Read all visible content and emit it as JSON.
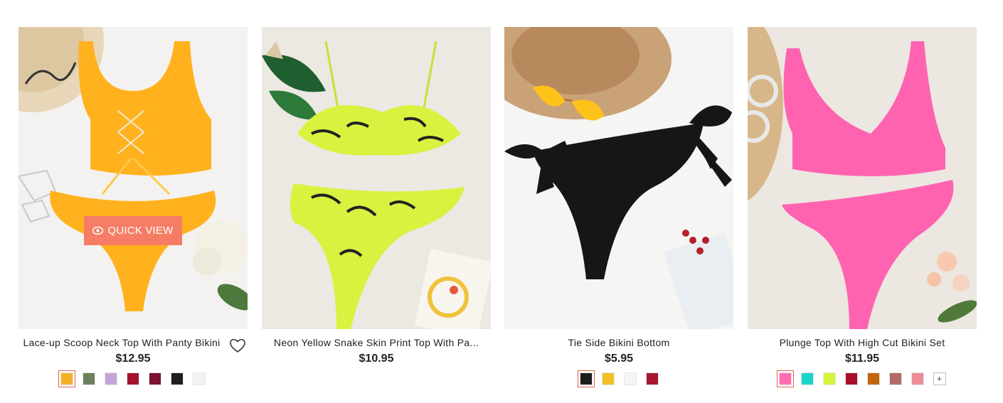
{
  "products": [
    {
      "name": "Lace-up Scoop Neck Top With Panty Bikini",
      "price": "$12.95",
      "quick_view_label": "QUICK VIEW",
      "colors": [
        "#f6b026",
        "#6e7f5c",
        "#c2a6d8",
        "#a3142c",
        "#7a1430",
        "#1e1e1e",
        "#f2f2f2"
      ],
      "selected_color": 0
    },
    {
      "name": "Neon Yellow Snake Skin Print Top With Pa...",
      "price": "$10.95",
      "colors": []
    },
    {
      "name": "Tie Side Bikini Bottom",
      "price": "$5.95",
      "colors": [
        "#1e1e1e",
        "#f2be2a",
        "#f5f5f5",
        "#a6162e"
      ],
      "selected_color": 0
    },
    {
      "name": "Plunge Top With High Cut Bikini Set",
      "price": "$11.95",
      "colors": [
        "#ff6bb3",
        "#19d6c8",
        "#d4f53a",
        "#a8102a",
        "#c3640e",
        "#b06a6a",
        "#ee8c98"
      ],
      "selected_color": 0,
      "more_label": "+"
    }
  ],
  "icons": {
    "wishlist": "heart-icon",
    "quick_view": "eye-icon"
  }
}
